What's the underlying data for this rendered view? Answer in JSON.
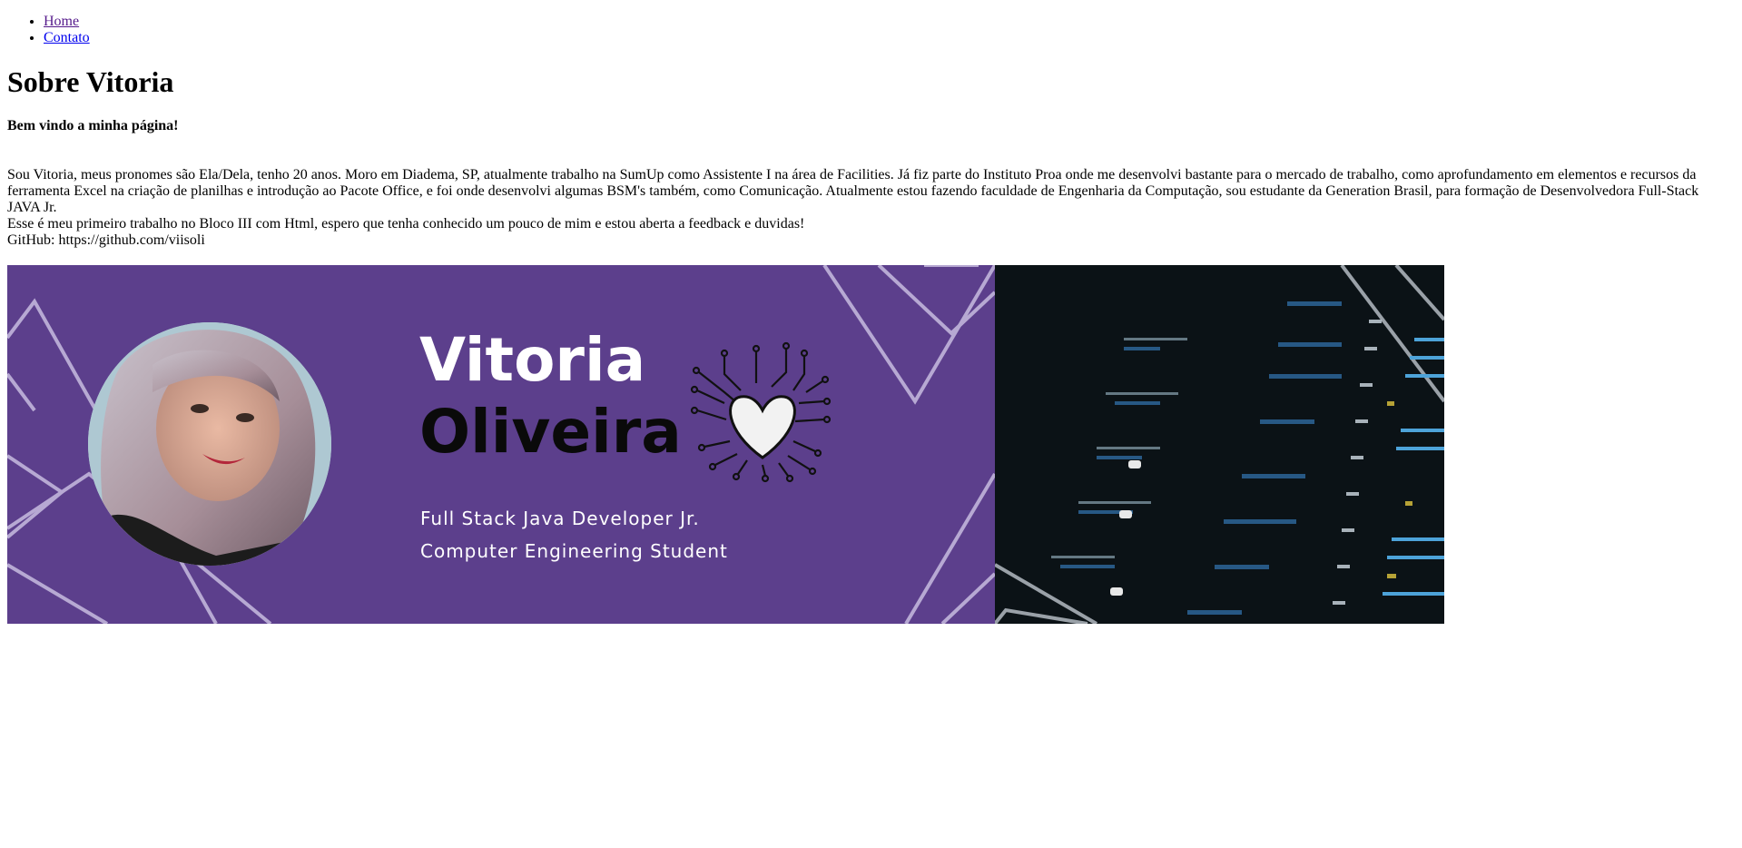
{
  "nav": {
    "items": [
      {
        "label": "Home"
      },
      {
        "label": "Contato"
      }
    ]
  },
  "page": {
    "title": "Sobre Vitoria",
    "welcome": "Bem vindo a minha página!"
  },
  "bio": {
    "line1": "Sou Vitoria, meus pronomes são Ela/Dela, tenho 20 anos. Moro em Diadema, SP, atualmente trabalho na SumUp como Assistente I na área de Facilities. Já fiz parte do Instituto Proa onde me desenvolvi bastante para o mercado de trabalho, como aprofundamento em elementos e recursos da ferramenta Excel na criação de planilhas e introdução ao Pacote Office, e foi onde desenvolvi algumas BSM's também, como Comunicação. Atualmente estou fazendo faculdade de Engenharia da Computação, sou estudante da Generation Brasil, para formação de Desenvolvedora Full-Stack JAVA Jr.",
    "line2": "Esse é meu primeiro trabalho no Bloco III com Html, espero que tenha conhecido um pouco de mim e estou aberta a feedback e duvidas!",
    "line3": "GitHub: https://github.com/viisoli"
  },
  "banner": {
    "name_first": "Vitoria",
    "name_last": "Oliveira",
    "role": "Full Stack Java Developer Jr.",
    "study": "Computer Engineering Student",
    "colors": {
      "purple": "#5c3f8c",
      "dark": "#0b1216",
      "line": "#b7a9d3",
      "heart": "#f2f2f2"
    }
  }
}
